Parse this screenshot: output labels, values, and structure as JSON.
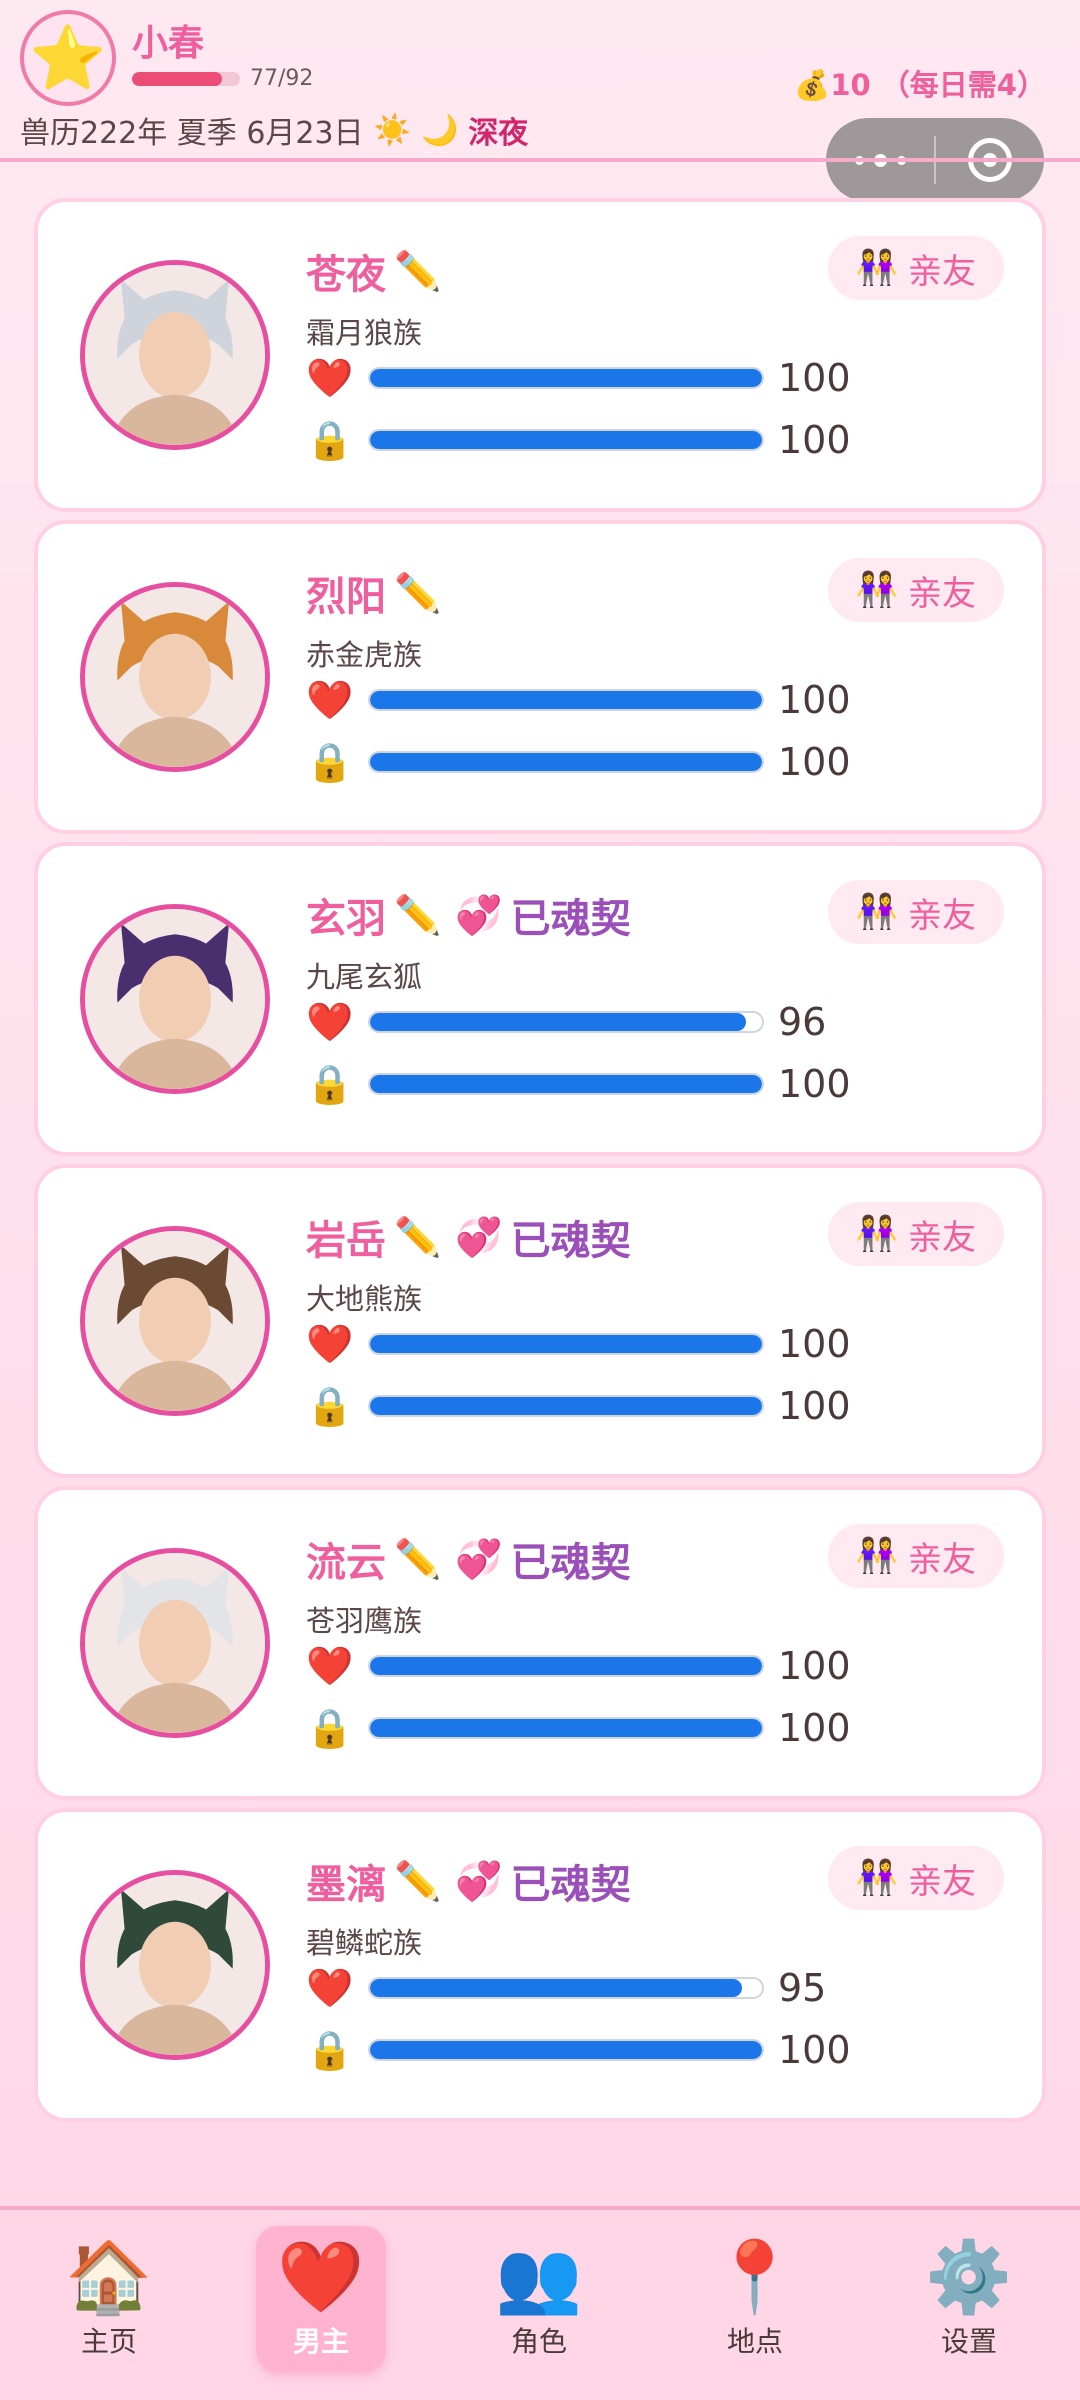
{
  "user": {
    "name": "小春",
    "avatar_icon": "⭐",
    "hp_text": "77/92",
    "hp_current": 77,
    "hp_max": 92
  },
  "date": {
    "text": "兽历222年 夏季 6月23日",
    "sun_icon": "☀️",
    "moon_icon": "🌙",
    "time": "深夜"
  },
  "coins": "💰10 （每日需4）",
  "characters": [
    {
      "name": "苍夜",
      "edit_icon": "✏️",
      "soul_icon": "",
      "soul": "",
      "race": "霜月狼族",
      "relation_icon": "👭",
      "relation": "亲友",
      "heart_icon": "❤️",
      "affection": 100,
      "lock_icon": "🔒",
      "lock": 100,
      "accent": "#cfd4dc"
    },
    {
      "name": "烈阳",
      "edit_icon": "✏️",
      "soul_icon": "",
      "soul": "",
      "race": "赤金虎族",
      "relation_icon": "👭",
      "relation": "亲友",
      "heart_icon": "❤️",
      "affection": 100,
      "lock_icon": "🔒",
      "lock": 100,
      "accent": "#d88a3a"
    },
    {
      "name": "玄羽",
      "edit_icon": "✏️",
      "soul_icon": "💞",
      "soul": "已魂契",
      "race": "九尾玄狐",
      "relation_icon": "👭",
      "relation": "亲友",
      "heart_icon": "❤️",
      "affection": 96,
      "lock_icon": "🔒",
      "lock": 100,
      "accent": "#4a2f6e"
    },
    {
      "name": "岩岳",
      "edit_icon": "✏️",
      "soul_icon": "💞",
      "soul": "已魂契",
      "race": "大地熊族",
      "relation_icon": "👭",
      "relation": "亲友",
      "heart_icon": "❤️",
      "affection": 100,
      "lock_icon": "🔒",
      "lock": 100,
      "accent": "#6b4a33"
    },
    {
      "name": "流云",
      "edit_icon": "✏️",
      "soul_icon": "💞",
      "soul": "已魂契",
      "race": "苍羽鹰族",
      "relation_icon": "👭",
      "relation": "亲友",
      "heart_icon": "❤️",
      "affection": 100,
      "lock_icon": "🔒",
      "lock": 100,
      "accent": "#e2e4e8"
    },
    {
      "name": "墨漓",
      "edit_icon": "✏️",
      "soul_icon": "💞",
      "soul": "已魂契",
      "race": "碧鳞蛇族",
      "relation_icon": "👭",
      "relation": "亲友",
      "heart_icon": "❤️",
      "affection": 95,
      "lock_icon": "🔒",
      "lock": 100,
      "accent": "#2f4a3a"
    }
  ],
  "nav": [
    {
      "icon": "🏠",
      "label": "主页",
      "active": false
    },
    {
      "icon": "❤️",
      "label": "男主",
      "active": true
    },
    {
      "icon": "👥",
      "label": "角色",
      "active": false
    },
    {
      "icon": "📍",
      "label": "地点",
      "active": false
    },
    {
      "icon": "⚙️",
      "label": "设置",
      "active": false
    }
  ]
}
